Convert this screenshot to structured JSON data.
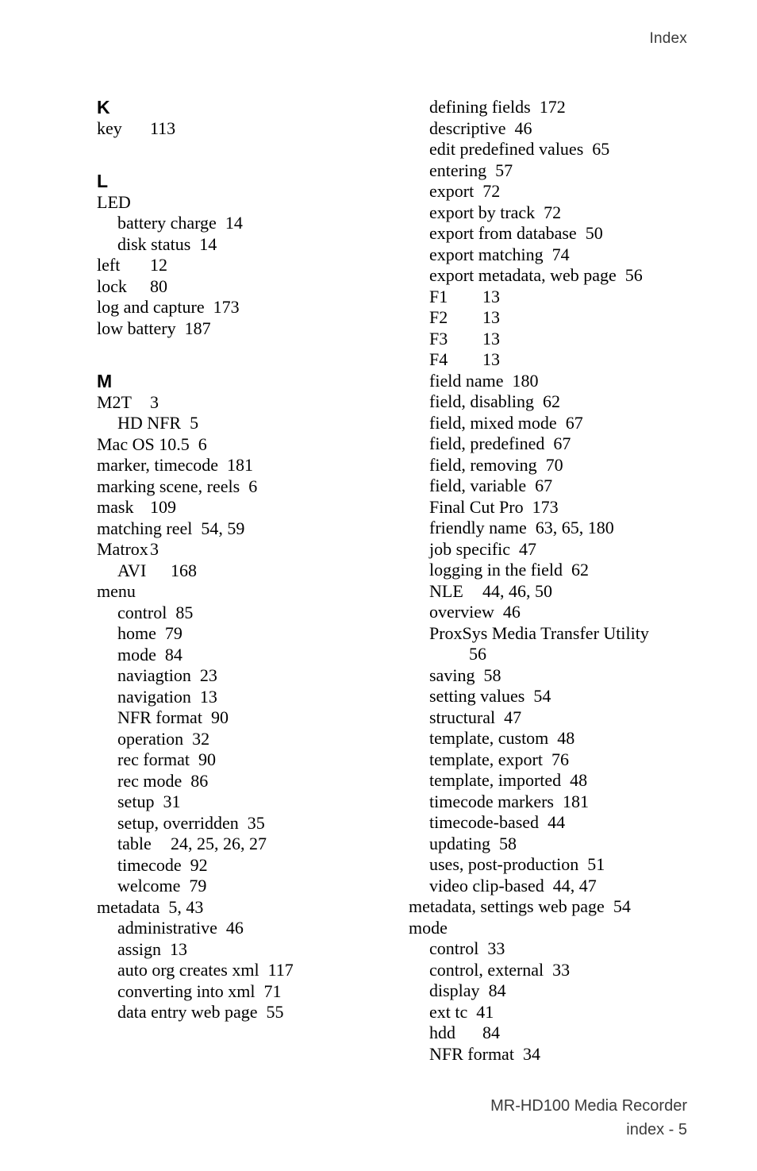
{
  "running_head": "Index",
  "footer": {
    "title": "MR-HD100 Media Recorder",
    "folio": "index - 5"
  },
  "left_column": [
    {
      "kind": "letter",
      "label": "K"
    },
    {
      "kind": "entry",
      "level": 1,
      "style": "tab",
      "term": "key",
      "pages": "113"
    },
    {
      "kind": "gap"
    },
    {
      "kind": "letter",
      "label": "L"
    },
    {
      "kind": "entry",
      "level": 1,
      "style": "none",
      "term": "LED",
      "pages": ""
    },
    {
      "kind": "entry",
      "level": 2,
      "style": "space",
      "term": "battery charge",
      "pages": "14"
    },
    {
      "kind": "entry",
      "level": 2,
      "style": "space",
      "term": "disk status",
      "pages": "14"
    },
    {
      "kind": "entry",
      "level": 1,
      "style": "tab",
      "term": "left",
      "pages": "12"
    },
    {
      "kind": "entry",
      "level": 1,
      "style": "tab",
      "term": "lock",
      "pages": "80"
    },
    {
      "kind": "entry",
      "level": 1,
      "style": "space",
      "term": "log and capture",
      "pages": "173"
    },
    {
      "kind": "entry",
      "level": 1,
      "style": "space",
      "term": "low battery",
      "pages": "187"
    },
    {
      "kind": "gap"
    },
    {
      "kind": "letter",
      "label": "M"
    },
    {
      "kind": "entry",
      "level": 1,
      "style": "tab",
      "term": "M2T",
      "pages": "3"
    },
    {
      "kind": "entry",
      "level": 2,
      "style": "space",
      "term": "HD NFR",
      "pages": "5"
    },
    {
      "kind": "entry",
      "level": 1,
      "style": "space",
      "term": "Mac OS 10.5",
      "pages": "6"
    },
    {
      "kind": "entry",
      "level": 1,
      "style": "space",
      "term": "marker, timecode",
      "pages": "181"
    },
    {
      "kind": "entry",
      "level": 1,
      "style": "space",
      "term": "marking scene, reels",
      "pages": "6"
    },
    {
      "kind": "entry",
      "level": 1,
      "style": "tab",
      "term": "mask",
      "pages": "109"
    },
    {
      "kind": "entry",
      "level": 1,
      "style": "space",
      "term": "matching reel",
      "pages": "54, 59"
    },
    {
      "kind": "entry",
      "level": 1,
      "style": "tab",
      "term": "Matrox",
      "pages": "3"
    },
    {
      "kind": "entry",
      "level": 2,
      "style": "tab",
      "term": "AVI",
      "pages": "168"
    },
    {
      "kind": "entry",
      "level": 1,
      "style": "none",
      "term": "menu",
      "pages": ""
    },
    {
      "kind": "entry",
      "level": 2,
      "style": "space",
      "term": "control",
      "pages": "85"
    },
    {
      "kind": "entry",
      "level": 2,
      "style": "space",
      "term": "home",
      "pages": "79"
    },
    {
      "kind": "entry",
      "level": 2,
      "style": "space",
      "term": "mode",
      "pages": "84"
    },
    {
      "kind": "entry",
      "level": 2,
      "style": "space",
      "term": "naviagtion",
      "pages": "23"
    },
    {
      "kind": "entry",
      "level": 2,
      "style": "space",
      "term": "navigation",
      "pages": "13"
    },
    {
      "kind": "entry",
      "level": 2,
      "style": "space",
      "term": "NFR format",
      "pages": "90"
    },
    {
      "kind": "entry",
      "level": 2,
      "style": "space",
      "term": "operation",
      "pages": "32"
    },
    {
      "kind": "entry",
      "level": 2,
      "style": "space",
      "term": "rec format",
      "pages": "90"
    },
    {
      "kind": "entry",
      "level": 2,
      "style": "space",
      "term": "rec mode",
      "pages": "86"
    },
    {
      "kind": "entry",
      "level": 2,
      "style": "space",
      "term": "setup",
      "pages": "31"
    },
    {
      "kind": "entry",
      "level": 2,
      "style": "space",
      "term": "setup, overridden",
      "pages": "35"
    },
    {
      "kind": "entry",
      "level": 2,
      "style": "tab",
      "term": "table",
      "pages": "24, 25, 26, 27"
    },
    {
      "kind": "entry",
      "level": 2,
      "style": "space",
      "term": "timecode",
      "pages": "92"
    },
    {
      "kind": "entry",
      "level": 2,
      "style": "space",
      "term": "welcome",
      "pages": "79"
    },
    {
      "kind": "entry",
      "level": 1,
      "style": "space",
      "term": "metadata",
      "pages": "5, 43"
    },
    {
      "kind": "entry",
      "level": 2,
      "style": "space",
      "term": "administrative",
      "pages": "46"
    },
    {
      "kind": "entry",
      "level": 2,
      "style": "space",
      "term": "assign",
      "pages": "13"
    },
    {
      "kind": "entry",
      "level": 2,
      "style": "space",
      "term": "auto org creates xml",
      "pages": "117"
    },
    {
      "kind": "entry",
      "level": 2,
      "style": "space",
      "term": "converting into xml",
      "pages": "71"
    },
    {
      "kind": "entry",
      "level": 2,
      "style": "space",
      "term": "data entry web page",
      "pages": "55"
    }
  ],
  "right_column": [
    {
      "kind": "entry",
      "level": 2,
      "style": "space",
      "term": "defining fields",
      "pages": "172"
    },
    {
      "kind": "entry",
      "level": 2,
      "style": "space",
      "term": "descriptive",
      "pages": "46"
    },
    {
      "kind": "entry",
      "level": 2,
      "style": "space",
      "term": "edit predefined values",
      "pages": "65"
    },
    {
      "kind": "entry",
      "level": 2,
      "style": "space",
      "term": "entering",
      "pages": "57"
    },
    {
      "kind": "entry",
      "level": 2,
      "style": "space",
      "term": "export",
      "pages": "72"
    },
    {
      "kind": "entry",
      "level": 2,
      "style": "space",
      "term": "export by track",
      "pages": "72"
    },
    {
      "kind": "entry",
      "level": 2,
      "style": "space",
      "term": "export from database",
      "pages": "50"
    },
    {
      "kind": "entry",
      "level": 2,
      "style": "space",
      "term": "export matching",
      "pages": "74"
    },
    {
      "kind": "entry",
      "level": 2,
      "style": "space",
      "term": "export metadata, web page",
      "pages": "56"
    },
    {
      "kind": "entry",
      "level": 2,
      "style": "tab",
      "term": "F1",
      "pages": "13"
    },
    {
      "kind": "entry",
      "level": 2,
      "style": "tab",
      "term": "F2",
      "pages": "13"
    },
    {
      "kind": "entry",
      "level": 2,
      "style": "tab",
      "term": "F3",
      "pages": "13"
    },
    {
      "kind": "entry",
      "level": 2,
      "style": "tab",
      "term": "F4",
      "pages": "13"
    },
    {
      "kind": "entry",
      "level": 2,
      "style": "space",
      "term": "field name",
      "pages": "180"
    },
    {
      "kind": "entry",
      "level": 2,
      "style": "space",
      "term": "field, disabling",
      "pages": "62"
    },
    {
      "kind": "entry",
      "level": 2,
      "style": "space",
      "term": "field, mixed mode",
      "pages": "67"
    },
    {
      "kind": "entry",
      "level": 2,
      "style": "space",
      "term": "field, predefined",
      "pages": "67"
    },
    {
      "kind": "entry",
      "level": 2,
      "style": "space",
      "term": "field, removing",
      "pages": "70"
    },
    {
      "kind": "entry",
      "level": 2,
      "style": "space",
      "term": "field, variable",
      "pages": "67"
    },
    {
      "kind": "entry",
      "level": 2,
      "style": "space",
      "term": "Final Cut Pro",
      "pages": "173"
    },
    {
      "kind": "entry",
      "level": 2,
      "style": "space",
      "term": "friendly name",
      "pages": "63, 65, 180"
    },
    {
      "kind": "entry",
      "level": 2,
      "style": "space",
      "term": "job specific",
      "pages": "47"
    },
    {
      "kind": "entry",
      "level": 2,
      "style": "space",
      "term": "logging in the field",
      "pages": "62"
    },
    {
      "kind": "entry",
      "level": 2,
      "style": "tab",
      "term": "NLE",
      "pages": "44, 46, 50"
    },
    {
      "kind": "entry",
      "level": 2,
      "style": "space",
      "term": "overview",
      "pages": "46"
    },
    {
      "kind": "wrapped",
      "level": 2,
      "term": "ProxSys Media Transfer Utility",
      "pages": "56"
    },
    {
      "kind": "entry",
      "level": 2,
      "style": "space",
      "term": "saving",
      "pages": "58"
    },
    {
      "kind": "entry",
      "level": 2,
      "style": "space",
      "term": "setting values",
      "pages": "54"
    },
    {
      "kind": "entry",
      "level": 2,
      "style": "space",
      "term": "structural",
      "pages": "47"
    },
    {
      "kind": "entry",
      "level": 2,
      "style": "space",
      "term": "template, custom",
      "pages": "48"
    },
    {
      "kind": "entry",
      "level": 2,
      "style": "space",
      "term": "template, export",
      "pages": "76"
    },
    {
      "kind": "entry",
      "level": 2,
      "style": "space",
      "term": "template, imported",
      "pages": "48"
    },
    {
      "kind": "entry",
      "level": 2,
      "style": "space",
      "term": "timecode markers",
      "pages": "181"
    },
    {
      "kind": "entry",
      "level": 2,
      "style": "space",
      "term": "timecode-based",
      "pages": "44"
    },
    {
      "kind": "entry",
      "level": 2,
      "style": "space",
      "term": "updating",
      "pages": "58"
    },
    {
      "kind": "entry",
      "level": 2,
      "style": "space",
      "term": "uses, post-production",
      "pages": "51"
    },
    {
      "kind": "entry",
      "level": 2,
      "style": "space",
      "term": "video clip-based",
      "pages": "44, 47"
    },
    {
      "kind": "entry",
      "level": 1,
      "style": "space",
      "term": "metadata, settings web page",
      "pages": "54"
    },
    {
      "kind": "entry",
      "level": 1,
      "style": "none",
      "term": "mode",
      "pages": ""
    },
    {
      "kind": "entry",
      "level": 2,
      "style": "space",
      "term": "control",
      "pages": "33"
    },
    {
      "kind": "entry",
      "level": 2,
      "style": "space",
      "term": "control, external",
      "pages": "33"
    },
    {
      "kind": "entry",
      "level": 2,
      "style": "space",
      "term": "display",
      "pages": "84"
    },
    {
      "kind": "entry",
      "level": 2,
      "style": "space",
      "term": "ext tc",
      "pages": "41"
    },
    {
      "kind": "entry",
      "level": 2,
      "style": "tab",
      "term": "hdd",
      "pages": "84"
    },
    {
      "kind": "entry",
      "level": 2,
      "style": "space",
      "term": "NFR format",
      "pages": "34"
    }
  ]
}
